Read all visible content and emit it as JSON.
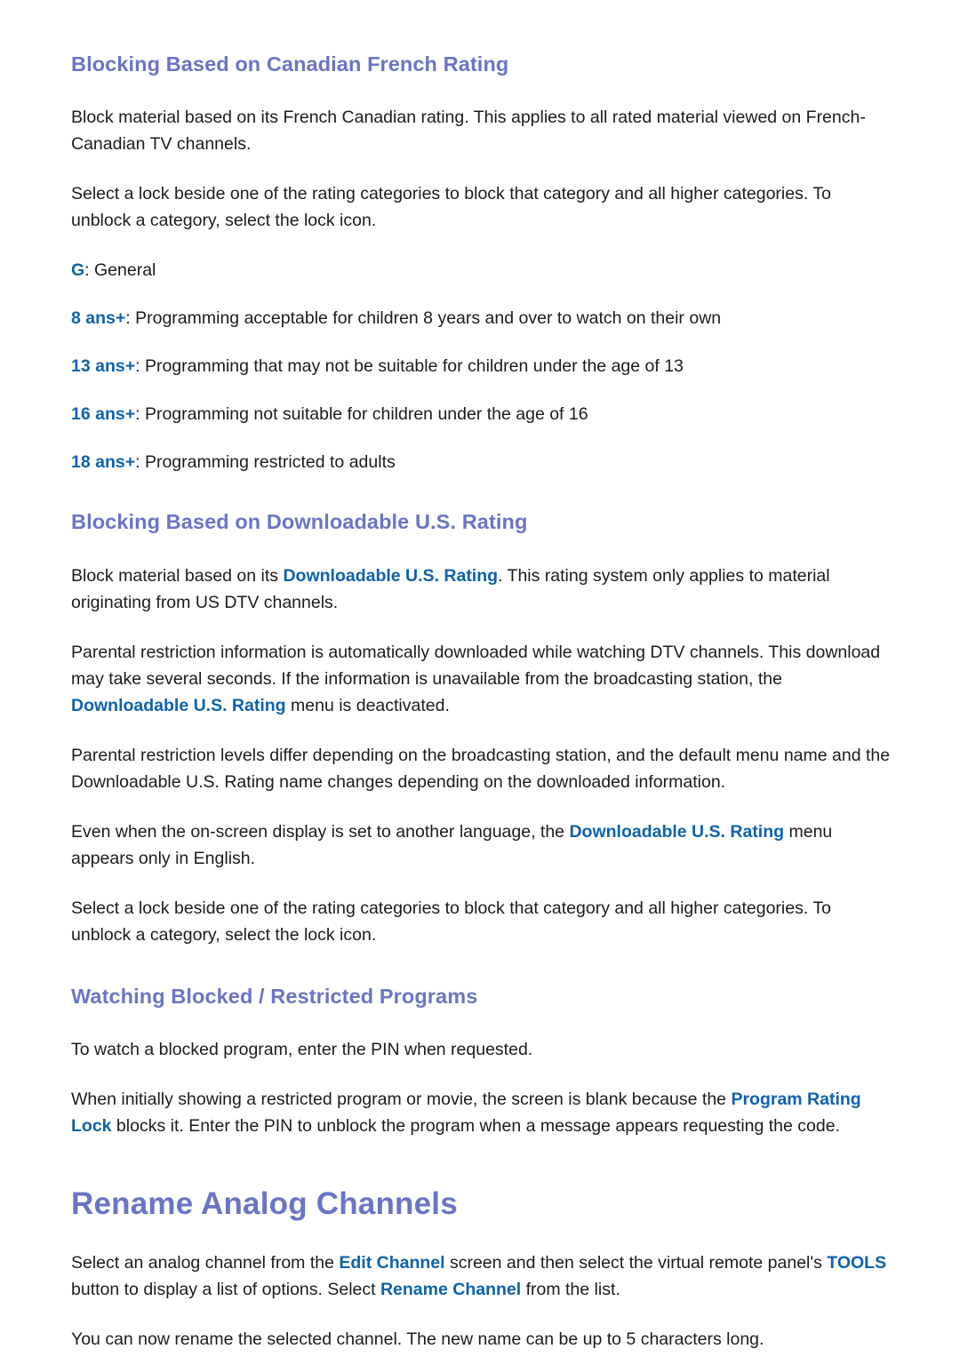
{
  "colors": {
    "heading": "#6b74c4",
    "accent_inline": "#0f62ac",
    "body_text": "#1c1c1c",
    "background": "#ffffff"
  },
  "sections": [
    {
      "heading": "Blocking Based on Canadian French Rating",
      "paragraphs": [
        "Block material based on its French Canadian rating. This applies to all rated material viewed on French-Canadian TV channels.",
        "Select a lock beside one of the rating categories to block that category and all higher categories. To unblock a category, select the lock icon."
      ],
      "rating_list": [
        {
          "key": "G",
          "separator": ": ",
          "description": "General"
        },
        {
          "key": "8 ans+",
          "separator": ": ",
          "description": "Programming acceptable for children 8 years and over to watch on their own"
        },
        {
          "key": "13 ans+",
          "separator": ": ",
          "description": "Programming that may not be suitable for children under the age of 13"
        },
        {
          "key": "16 ans+",
          "separator": ": ",
          "description": "Programming not suitable for children under the age of 16"
        },
        {
          "key": "18 ans+",
          "separator": ": ",
          "description": "Programming restricted to adults"
        }
      ]
    },
    {
      "heading": "Blocking Based on Downloadable U.S. Rating",
      "paragraph_1_pre": "Block material based on its ",
      "paragraph_1_hl": "Downloadable U.S. Rating",
      "paragraph_1_post": ". This rating system only applies to material originating from US DTV channels.",
      "paragraph_2_pre": "Parental restriction information is automatically downloaded while watching DTV channels. This download may take several seconds. If the information is unavailable from the broadcasting station, the ",
      "paragraph_2_hl": "Downloadable U.S. Rating",
      "paragraph_2_post": " menu is deactivated.",
      "paragraph_3": "Parental restriction levels differ depending on the broadcasting station, and the default menu name and the Downloadable U.S. Rating name changes depending on the downloaded information.",
      "paragraph_4_pre": "Even when the on-screen display is set to another language, the ",
      "paragraph_4_hl": "Downloadable U.S. Rating",
      "paragraph_4_post": " menu appears only in English.",
      "paragraph_5": "Select a lock beside one of the rating categories to block that category and all higher categories. To unblock a category, select the lock icon."
    },
    {
      "heading": "Watching Blocked / Restricted Programs",
      "paragraph_1": "To watch a blocked program, enter the PIN when requested.",
      "paragraph_2_pre": "When initially showing a restricted program or movie, the screen is blank because the ",
      "paragraph_2_hl": "Program Rating Lock",
      "paragraph_2_post": " blocks it. Enter the PIN to unblock the program when a message appears requesting the code."
    }
  ],
  "chapter": {
    "title": "Rename Analog Channels",
    "paragraph_1_pre": "Select an analog channel from the ",
    "paragraph_1_hl_a": "Edit Channel",
    "paragraph_1_mid_a": " screen and then select the virtual remote panel's ",
    "paragraph_1_hl_b": "TOOLS",
    "paragraph_1_mid_b": " button to display a list of options. Select ",
    "paragraph_1_hl_c": "Rename Channel",
    "paragraph_1_post": " from the list.",
    "paragraph_2": "You can now rename the selected channel. The new name can be up to 5 characters long."
  }
}
